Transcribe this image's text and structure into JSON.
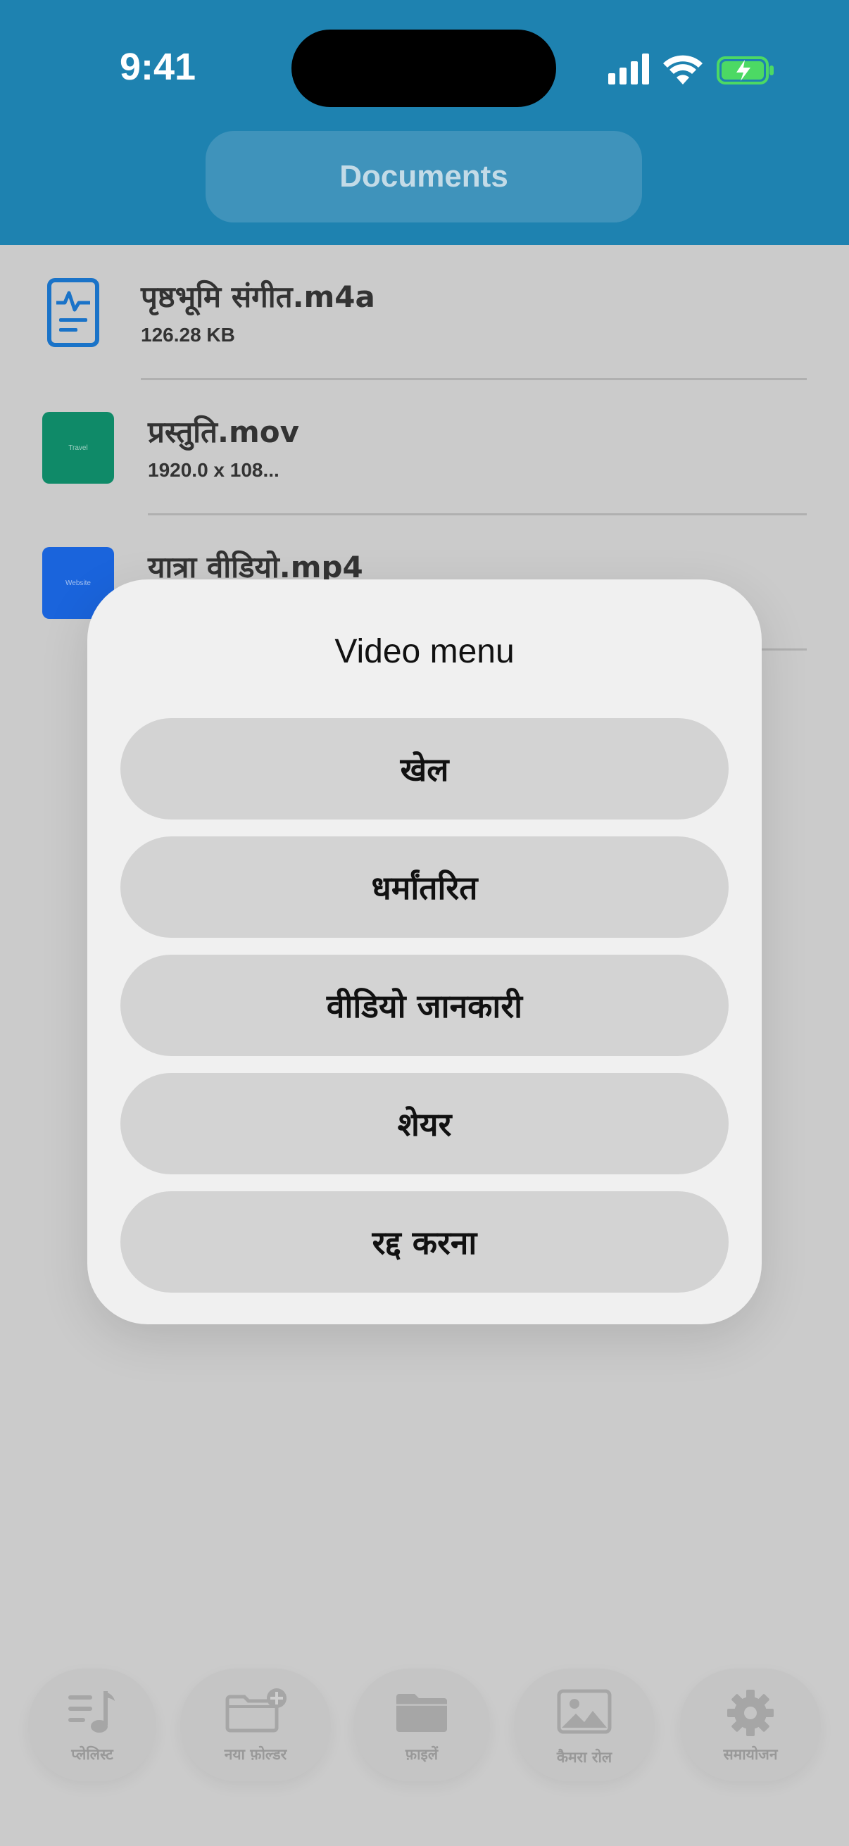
{
  "status_bar": {
    "time": "9:41"
  },
  "header": {
    "title": "Documents"
  },
  "files": [
    {
      "name": "पृष्ठभूमि संगीत.m4a",
      "meta": "126.28 KB",
      "thumb_label": ""
    },
    {
      "name": "प्रस्तुति.mov",
      "meta": "1920.0 x 108...",
      "thumb_label": "Travel"
    },
    {
      "name": "यात्रा वीडियो.mp4",
      "meta": "",
      "thumb_label": "Website"
    }
  ],
  "modal": {
    "title": "Video menu",
    "buttons": [
      "खेल",
      "धर्मांतरित",
      "वीडियो जानकारी",
      "शेयर",
      "रद्द करना"
    ]
  },
  "tabs": [
    "प्लेलिस्ट",
    "नया फ़ोल्डर",
    "फ़ाइलें",
    "कैमरा रोल",
    "समायोजन"
  ],
  "colors": {
    "header": "#1e82b0",
    "thumb_travel": "#0f8a68",
    "thumb_website": "#1a64dc",
    "modal_bg": "#f0f0f0",
    "button_bg": "#d3d3d3"
  }
}
